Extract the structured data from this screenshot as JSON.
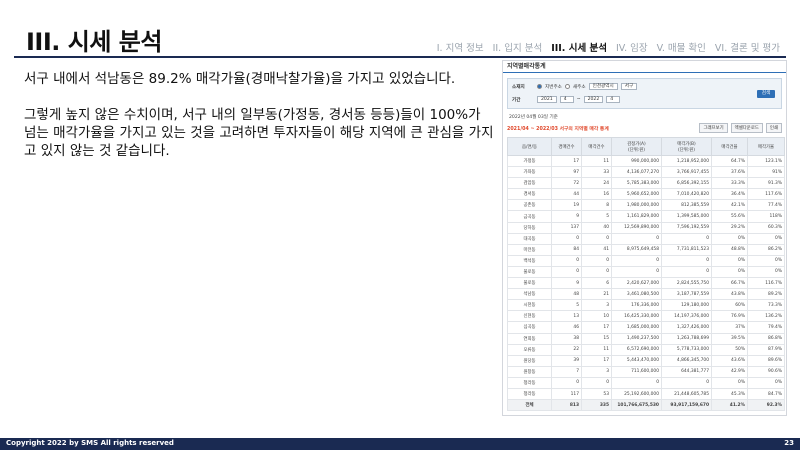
{
  "slide": {
    "title": "III. 시세 분석",
    "steps": [
      {
        "label": "I. 지역 정보",
        "active": false
      },
      {
        "label": "II. 입지 분석",
        "active": false
      },
      {
        "label": "III. 시세 분석",
        "active": true
      },
      {
        "label": "IV. 임장",
        "active": false
      },
      {
        "label": "V. 매물 확인",
        "active": false
      },
      {
        "label": "VI. 결론 및 평가",
        "active": false
      }
    ],
    "paragraph1": "서구 내에서 석남동은 89.2% 매각가율(경매낙찰가율)을 가지고 있었습니다.",
    "paragraph2": "그렇게 높지 않은 수치이며, 서구 내의 일부동(가정동, 경서동 등등)들이 100%가 넘는 매각가율을 가지고 있는 것을 고려하면 투자자들이 해당 지역에 큰 관심을 가지고 있지 않는 것 같습니다."
  },
  "panel": {
    "title": "지역별매각통계",
    "search": {
      "area_label": "소재지",
      "radio1": "지번주소",
      "radio2": "새주소",
      "city": "인천광역시",
      "district": "서구",
      "period_label": "기간",
      "from_year": "2021",
      "from_month": "4",
      "to_year": "2022",
      "to_month": "4",
      "button": "검색"
    },
    "reference_date": "2022년 04월 03일 기준",
    "subtitle": "2021/04 ~ 2022/03 서구의 지역별 매각 통계",
    "tools": [
      "그래프보기",
      "엑셀다운로드",
      "인쇄"
    ],
    "columns": [
      "읍/면/동",
      "경매건수",
      "매각건수",
      "감정가(A)\n(단위:원)",
      "매각가(B)\n(단위:원)",
      "매각건율",
      "매각가율"
    ],
    "rows": [
      [
        "가정동",
        "17",
        "11",
        "990,000,000",
        "1,218,952,000",
        "64.7%",
        "123.1%"
      ],
      [
        "가좌동",
        "97",
        "33",
        "4,136,077,270",
        "3,766,917,455",
        "37.6%",
        "91%"
      ],
      [
        "검암동",
        "72",
        "24",
        "5,785,383,000",
        "6,856,392,155",
        "33.3%",
        "91.3%"
      ],
      [
        "경서동",
        "44",
        "16",
        "5,960,652,000",
        "7,010,420,820",
        "36.4%",
        "117.6%"
      ],
      [
        "공촌동",
        "19",
        "8",
        "1,980,000,000",
        "812,385,559",
        "42.1%",
        "77.4%"
      ],
      [
        "금곡동",
        "9",
        "5",
        "1,161,829,000",
        "1,399,585,000",
        "55.6%",
        "118%"
      ],
      [
        "당하동",
        "137",
        "40",
        "12,569,890,000",
        "7,596,192,559",
        "29.2%",
        "60.3%"
      ],
      [
        "대곡동",
        "0",
        "0",
        "0",
        "0",
        "0%",
        "0%"
      ],
      [
        "마전동",
        "84",
        "41",
        "8,975,649,458",
        "7,731,811,523",
        "48.8%",
        "86.2%"
      ],
      [
        "백석동",
        "0",
        "0",
        "0",
        "0",
        "0%",
        "0%"
      ],
      [
        "불로동",
        "0",
        "0",
        "0",
        "0",
        "0%",
        "0%"
      ],
      [
        "불로동",
        "9",
        "6",
        "2,420,627,000",
        "2,824,555,750",
        "66.7%",
        "116.7%"
      ],
      [
        "석남동",
        "48",
        "21",
        "3,461,080,500",
        "3,187,787,559",
        "43.8%",
        "89.2%"
      ],
      [
        "시천동",
        "5",
        "3",
        "176,336,000",
        "129,180,000",
        "60%",
        "73.3%"
      ],
      [
        "신현동",
        "13",
        "10",
        "16,425,330,000",
        "14,197,376,000",
        "76.9%",
        "136.2%"
      ],
      [
        "심곡동",
        "46",
        "17",
        "1,685,000,000",
        "1,327,426,000",
        "37%",
        "79.4%"
      ],
      [
        "연희동",
        "38",
        "15",
        "1,490,237,500",
        "1,263,788,699",
        "39.5%",
        "86.8%"
      ],
      [
        "오류동",
        "22",
        "11",
        "6,572,690,000",
        "5,778,733,000",
        "50%",
        "87.9%"
      ],
      [
        "원당동",
        "39",
        "17",
        "5,443,470,000",
        "4,866,345,700",
        "43.6%",
        "89.6%"
      ],
      [
        "원창동",
        "7",
        "3",
        "711,600,000",
        "644,381,777",
        "42.9%",
        "90.6%"
      ],
      [
        "청라동",
        "0",
        "0",
        "0",
        "0",
        "0%",
        "0%"
      ],
      [
        "청라동",
        "117",
        "53",
        "25,192,600,000",
        "21,448,605,785",
        "45.3%",
        "84.7%"
      ]
    ],
    "total": [
      "전체",
      "813",
      "335",
      "101,766,675,530",
      "93,917,159,670",
      "41.2%",
      "92.3%"
    ]
  },
  "footer": {
    "copyright": "Copyright 2022 by SMS All rights reserved",
    "page_number": "23"
  }
}
